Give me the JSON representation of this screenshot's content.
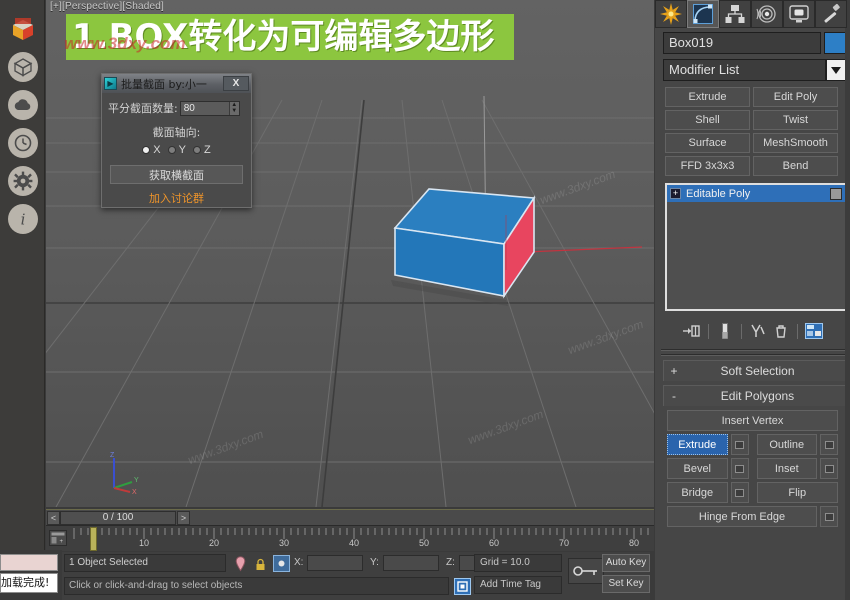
{
  "viewport": {
    "label": "[+][Perspective][Shaded]",
    "banner_text": "1.BOX转化为可编辑多边形",
    "banner_color": "#8cc63f",
    "watermark": "www.3dxy.com",
    "watermark_red": "www.3dxy.com",
    "box_top_color": "#2b7fc0",
    "box_face_color": "#e8455f",
    "axis": {
      "x": "X",
      "y": "Y",
      "z": "Z"
    }
  },
  "left_rail": {
    "items": [
      {
        "name": "course-cube-icon",
        "label": ""
      },
      {
        "name": "cube-icon",
        "label": ""
      },
      {
        "name": "cloud-icon",
        "label": ""
      },
      {
        "name": "clock-icon",
        "label": ""
      },
      {
        "name": "gear-icon",
        "label": ""
      },
      {
        "name": "info-icon",
        "label": ""
      }
    ]
  },
  "dialog": {
    "title": "批量截面 by:小一",
    "close_label": "X",
    "count_label": "平分截面数量:",
    "count_value": "80",
    "axis_label": "截面轴向:",
    "axis_options": [
      {
        "label": "X",
        "selected": true
      },
      {
        "label": "Y",
        "selected": false
      },
      {
        "label": "Z",
        "selected": false
      }
    ],
    "action_button": "获取横截面",
    "link_text": "加入讨论群"
  },
  "time_slider": {
    "prev_label": "<",
    "next_label": ">",
    "value": "0 / 100"
  },
  "track_bar": {
    "ticks": [
      "10",
      "20",
      "30",
      "40",
      "50",
      "60",
      "70",
      "80"
    ]
  },
  "status_bar": {
    "selection": "1 Object Selected",
    "prompt": "Click or click-and-drag to select objects",
    "x_label": "X:",
    "y_label": "Y:",
    "z_label": "Z:",
    "x_value": "",
    "y_value": "",
    "z_value": "",
    "grid": "Grid = 10.0",
    "time_tag": "Add Time Tag",
    "auto_key": "Auto Key",
    "set_key": "Set Key"
  },
  "browser_load": {
    "text": "加载完成!"
  },
  "command_panel": {
    "tabs": [
      {
        "name": "create-tab",
        "active": false
      },
      {
        "name": "modify-tab",
        "active": true
      },
      {
        "name": "hierarchy-tab",
        "active": false
      },
      {
        "name": "motion-tab",
        "active": false
      },
      {
        "name": "display-tab",
        "active": false
      },
      {
        "name": "utilities-tab",
        "active": false
      }
    ],
    "object_name": "Box019",
    "object_color": "#2d7fc6",
    "modifier_list": "Modifier List",
    "modifier_buttons": [
      "Extrude",
      "Edit Poly",
      "Shell",
      "Twist",
      "Surface",
      "MeshSmooth",
      "FFD 3x3x3",
      "Bend"
    ],
    "stack": [
      {
        "label": "Editable Poly",
        "expanded": false,
        "selected": true
      }
    ],
    "stack_tools": [
      "pin-stack-icon",
      "show-end-result-icon",
      "make-unique-icon",
      "remove-modifier-icon",
      "configure-modifier-sets-icon"
    ],
    "rollouts": [
      {
        "sign": "+",
        "title": "Soft Selection"
      },
      {
        "sign": "-",
        "title": "Edit Polygons"
      }
    ],
    "edit_polygons": {
      "insert_vertex": "Insert Vertex",
      "buttons": [
        {
          "label": "Extrude",
          "active": true,
          "settings": true
        },
        {
          "label": "Outline",
          "active": false,
          "settings": true
        },
        {
          "label": "Bevel",
          "active": false,
          "settings": true
        },
        {
          "label": "Inset",
          "active": false,
          "settings": true
        },
        {
          "label": "Bridge",
          "active": false,
          "settings": true
        },
        {
          "label": "Flip",
          "active": false,
          "settings": false
        },
        {
          "label": "Hinge From Edge",
          "active": false,
          "settings": true
        }
      ]
    }
  }
}
